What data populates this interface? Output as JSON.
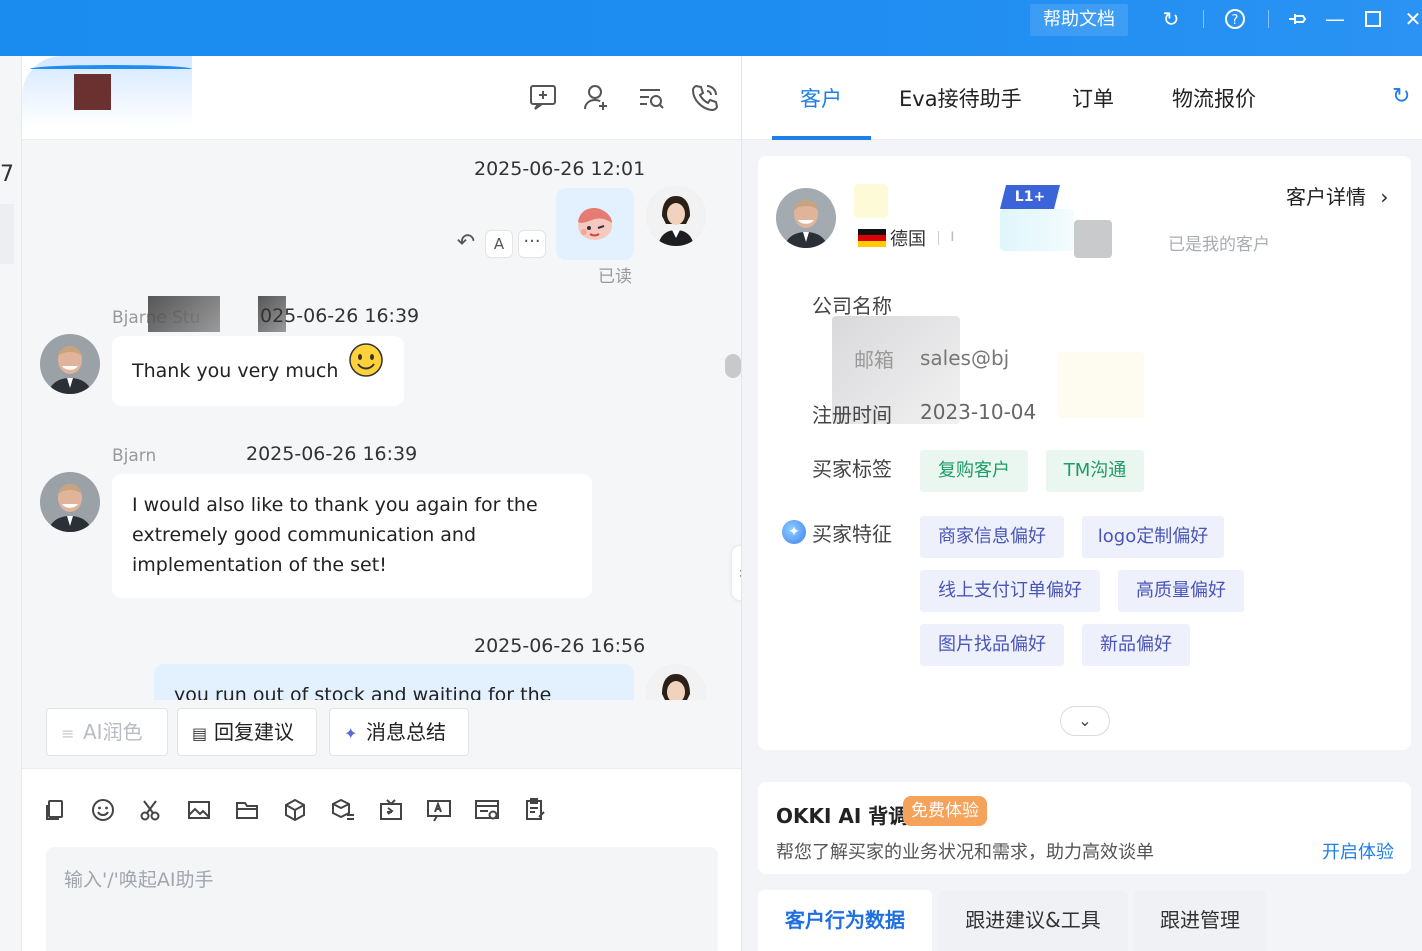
{
  "titlebar": {
    "help_label": "帮助文档",
    "icons": [
      "refresh-icon",
      "help-icon",
      "pin-icon",
      "minimize-icon",
      "maximize-icon",
      "close-icon"
    ]
  },
  "left_sliver": {
    "digit": "7"
  },
  "chat": {
    "header_icons": [
      "add-chat-icon",
      "add-contact-icon",
      "search-messages-icon",
      "call-icon"
    ],
    "messages": [
      {
        "side": "me",
        "timestamp": "2025-06-26 12:01",
        "content": "sticker",
        "read": "已读"
      },
      {
        "side": "them",
        "sender": "Bjarne Stu",
        "timestamp": "025-06-26 16:39",
        "text": "Thank you very much",
        "emoji": "smile-emoji"
      },
      {
        "side": "them",
        "sender": "Bjarn",
        "timestamp": "2025-06-26 16:39",
        "lines": [
          "I would also like to thank you again for the",
          "extremely good communication and",
          "implementation of the set!"
        ]
      },
      {
        "side": "me",
        "timestamp": "2025-06-26 16:56",
        "text": "you run out of stock and waiting for the"
      }
    ],
    "ai_buttons": [
      {
        "label": "AI润色",
        "icon": "ai-polish-icon",
        "disabled": true
      },
      {
        "label": "回复建议",
        "icon": "reply-suggestion-icon",
        "disabled": false
      },
      {
        "label": "消息总结",
        "icon": "sparkle-icon",
        "disabled": false
      }
    ],
    "toolbar_icons": [
      "copy-icon",
      "emoji-icon",
      "scissors-icon",
      "image-icon",
      "folder-icon",
      "product-icon",
      "catalog-icon",
      "video-icon",
      "translate-icon",
      "card-icon",
      "template-icon"
    ],
    "input_placeholder": "输入'/'唤起AI助手"
  },
  "right": {
    "tabs": [
      "客户",
      "Eva接待助手",
      "订单",
      "物流报价"
    ],
    "active_tab": 0,
    "customer": {
      "level_badge": "L1+",
      "country": "德国",
      "country_fragment": "ı",
      "detail_link": "客户详情",
      "status": "已是我的客户",
      "fields": [
        {
          "label": "公司名称",
          "value": ""
        },
        {
          "label": "邮箱",
          "value": "sales@bj"
        },
        {
          "label": "注册时间",
          "value": "2023-10-04"
        }
      ],
      "buyer_tags_label": "买家标签",
      "buyer_tags": [
        "复购客户",
        "TM沟通"
      ],
      "features_label": "买家特征",
      "features": [
        "商家信息偏好",
        "logo定制偏好",
        "线上支付订单偏好",
        "高质量偏好",
        "图片找品偏好",
        "新品偏好"
      ]
    },
    "ai_card": {
      "title": "OKKI AI 背调",
      "badge": "免费体验",
      "description": "帮您了解买家的业务状况和需求，助力高效谈单",
      "link": "开启体验"
    },
    "bottom_tabs": [
      "客户行为数据",
      "跟进建议&工具",
      "跟进管理"
    ],
    "bottom_active": 0
  },
  "colors": {
    "titlebar": "#1a8cf0",
    "accent": "#1f7fe8",
    "green_tag": "#1c9c66",
    "purple_tag": "#4a55b8",
    "ai_badge": "#f5a25b"
  }
}
